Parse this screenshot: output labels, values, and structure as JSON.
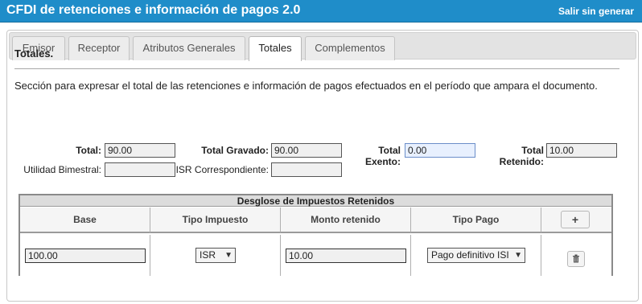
{
  "header": {
    "title": "CFDI de retenciones e información de pagos 2.0",
    "exit_label": "Salir sin generar"
  },
  "tabs": [
    {
      "label": "Emisor",
      "active": false
    },
    {
      "label": "Receptor",
      "active": false
    },
    {
      "label": "Atributos Generales",
      "active": false
    },
    {
      "label": "Totales",
      "active": true
    },
    {
      "label": "Complementos",
      "active": false
    }
  ],
  "section": {
    "title": "Totales.",
    "description": "Sección para expresar el total de las retenciones e información de pagos efectuados en el período que ampara el documento."
  },
  "fields": {
    "total": {
      "label": "Total:",
      "value": "90.00"
    },
    "total_gravado": {
      "label": "Total Gravado:",
      "value": "90.00"
    },
    "total_exento": {
      "label": "Total Exento:",
      "value": "0.00"
    },
    "total_retenido": {
      "label": "Total Retenido:",
      "value": "10.00"
    },
    "utilidad_bimestral": {
      "label": "Utilidad Bimestral:",
      "value": ""
    },
    "isr_correspondiente": {
      "label": "ISR Correspondiente:",
      "value": ""
    }
  },
  "grid": {
    "caption": "Desglose de Impuestos Retenidos",
    "columns": [
      "Base",
      "Tipo Impuesto",
      "Monto retenido",
      "Tipo Pago"
    ],
    "add_icon": "plus-icon",
    "delete_icon": "trash-icon",
    "rows": [
      {
        "base": "100.00",
        "tipo_impuesto": "ISR",
        "monto_retenido": "10.00",
        "tipo_pago": "Pago definitivo ISI"
      }
    ]
  }
}
